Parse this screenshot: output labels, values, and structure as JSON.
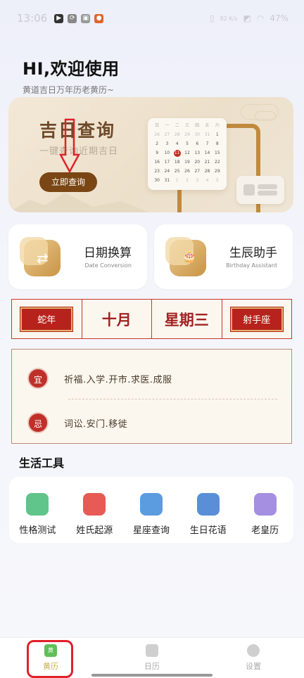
{
  "status_bar": {
    "time": "13:06",
    "right_text": "82 K/s",
    "battery": "47%"
  },
  "greeting": {
    "title": "HI,欢迎使用",
    "subtitle": "黄道吉日万年历老黄历~"
  },
  "hero": {
    "title": "吉日查询",
    "subtitle": "一键查询近期吉日",
    "button_label": "立即查询",
    "calendar": {
      "weekdays": [
        "日",
        "一",
        "二",
        "三",
        "四",
        "五",
        "六"
      ],
      "days": [
        "26",
        "27",
        "28",
        "29",
        "30",
        "31",
        "1",
        "2",
        "3",
        "4",
        "5",
        "6",
        "7",
        "8",
        "9",
        "10",
        "11",
        "12",
        "13",
        "14",
        "15",
        "16",
        "17",
        "18",
        "19",
        "20",
        "21",
        "22",
        "23",
        "24",
        "25",
        "26",
        "27",
        "28",
        "29",
        "30",
        "31",
        "1",
        "2",
        "3",
        "4",
        "5"
      ],
      "selected": "11"
    }
  },
  "tools": [
    {
      "title": "日期换算",
      "subtitle": "Date Conversion",
      "icon": "swap-arrows-icon",
      "glyph": "⇄"
    },
    {
      "title": "生辰助手",
      "subtitle": "Birthday Assistant",
      "icon": "birthday-cake-icon",
      "glyph": "🎂"
    }
  ],
  "info_bar": {
    "zodiac": "蛇年",
    "month": "十月",
    "weekday": "星期三",
    "constellation": "射手座"
  },
  "yiji": {
    "yi_badge": "宜",
    "yi_text": "祈福.入学.开市.求医.成服",
    "ji_badge": "忌",
    "ji_text": "词讼.安门.移徙"
  },
  "life_tools": {
    "section_title": "生活工具",
    "items": [
      {
        "label": "性格测试",
        "icon": "personality-test-icon",
        "color": "#5fc58a"
      },
      {
        "label": "姓氏起源",
        "icon": "surname-origin-icon",
        "color": "#e75a56"
      },
      {
        "label": "星座查询",
        "icon": "constellation-icon",
        "color": "#5b9be0"
      },
      {
        "label": "生日花语",
        "icon": "birthday-flower-icon",
        "color": "#5a8fd8"
      },
      {
        "label": "老皇历",
        "icon": "old-almanac-icon",
        "color": "#a58fe0"
      }
    ]
  },
  "bottom_nav": {
    "items": [
      {
        "label": "黄历",
        "icon": "almanac-icon",
        "badge": "黄"
      },
      {
        "label": "日历",
        "icon": "calendar-icon"
      },
      {
        "label": "设置",
        "icon": "settings-gear-icon"
      }
    ]
  },
  "colors": {
    "accent_red": "#c7362d",
    "gold_brown": "#7a4614",
    "nav_active": "#c8b04a"
  }
}
